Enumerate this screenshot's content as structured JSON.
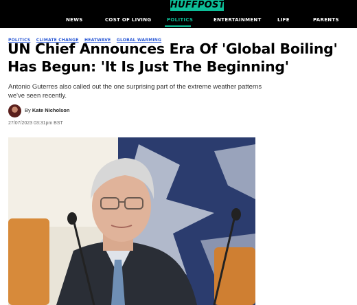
{
  "header": {
    "logo": "HUFFPOST",
    "nav": [
      "NEWS",
      "COST OF LIVING",
      "POLITICS",
      "ENTERTAINMENT",
      "LIFE",
      "PARENTS"
    ],
    "active_nav": "POLITICS",
    "accent_color": "#0dbe98"
  },
  "article": {
    "tags": [
      "POLITICS",
      "CLIMATE CHANGE",
      "HEATWAVE",
      "GLOBAL WARMING"
    ],
    "headline": "UN Chief Announces Era Of 'Global Boiling' Has Begun: 'It Is Just The Beginning'",
    "subhead": "Antonio Guterres also called out the one surprising part of the extreme weather patterns we've seen recently.",
    "byline_prefix": "By",
    "author": "Kate Nicholson",
    "timestamp": "27/07/2023 03:31pm BST",
    "tag_color": "#2d5bd6"
  }
}
